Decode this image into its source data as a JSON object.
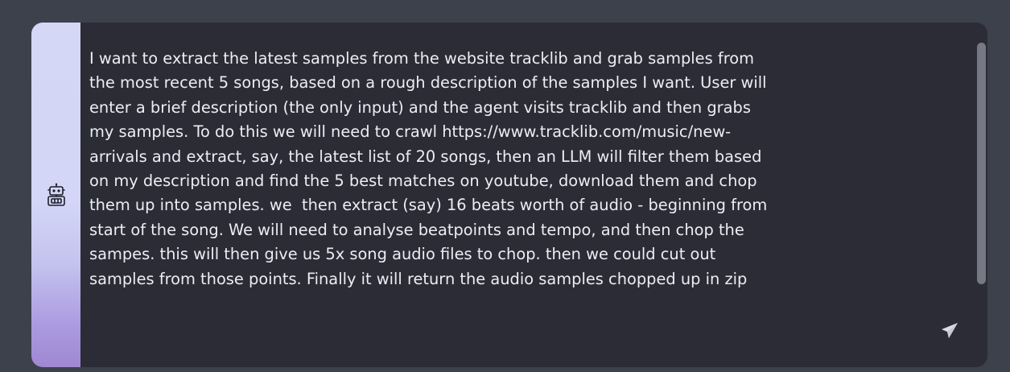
{
  "composer": {
    "message_lines": [
      "I want to extract the latest samples from the website tracklib and grab samples from",
      "the most recent 5 songs, based on a rough description of the samples I want. User will",
      "enter a brief description (the only input) and the agent visits tracklib and then grabs",
      "my samples. To do this we will need to crawl https://www.tracklib.com/music/new-",
      "arrivals and extract, say, the latest list of 20 songs, then an LLM will filter them based",
      "on my description and find the 5 best matches on youtube, download them and chop",
      "them up into samples. we  then extract (say) 16 beats worth of audio - beginning from",
      "start of the song. We will need to analyse beatpoints and tempo, and then chop the",
      "sampes. this will then give us 5x song audio files to chop. then we could cut out",
      "samples from those points. Finally it will return the audio samples chopped up in zip"
    ],
    "agent_icon": "robot-icon",
    "send_icon": "paper-plane-icon"
  },
  "colors": {
    "page_background": "#3d414b",
    "input_background": "#2b2c36",
    "text": "#eceef3",
    "accent_top": "#d5d7f6",
    "accent_bottom": "#a087d2"
  }
}
